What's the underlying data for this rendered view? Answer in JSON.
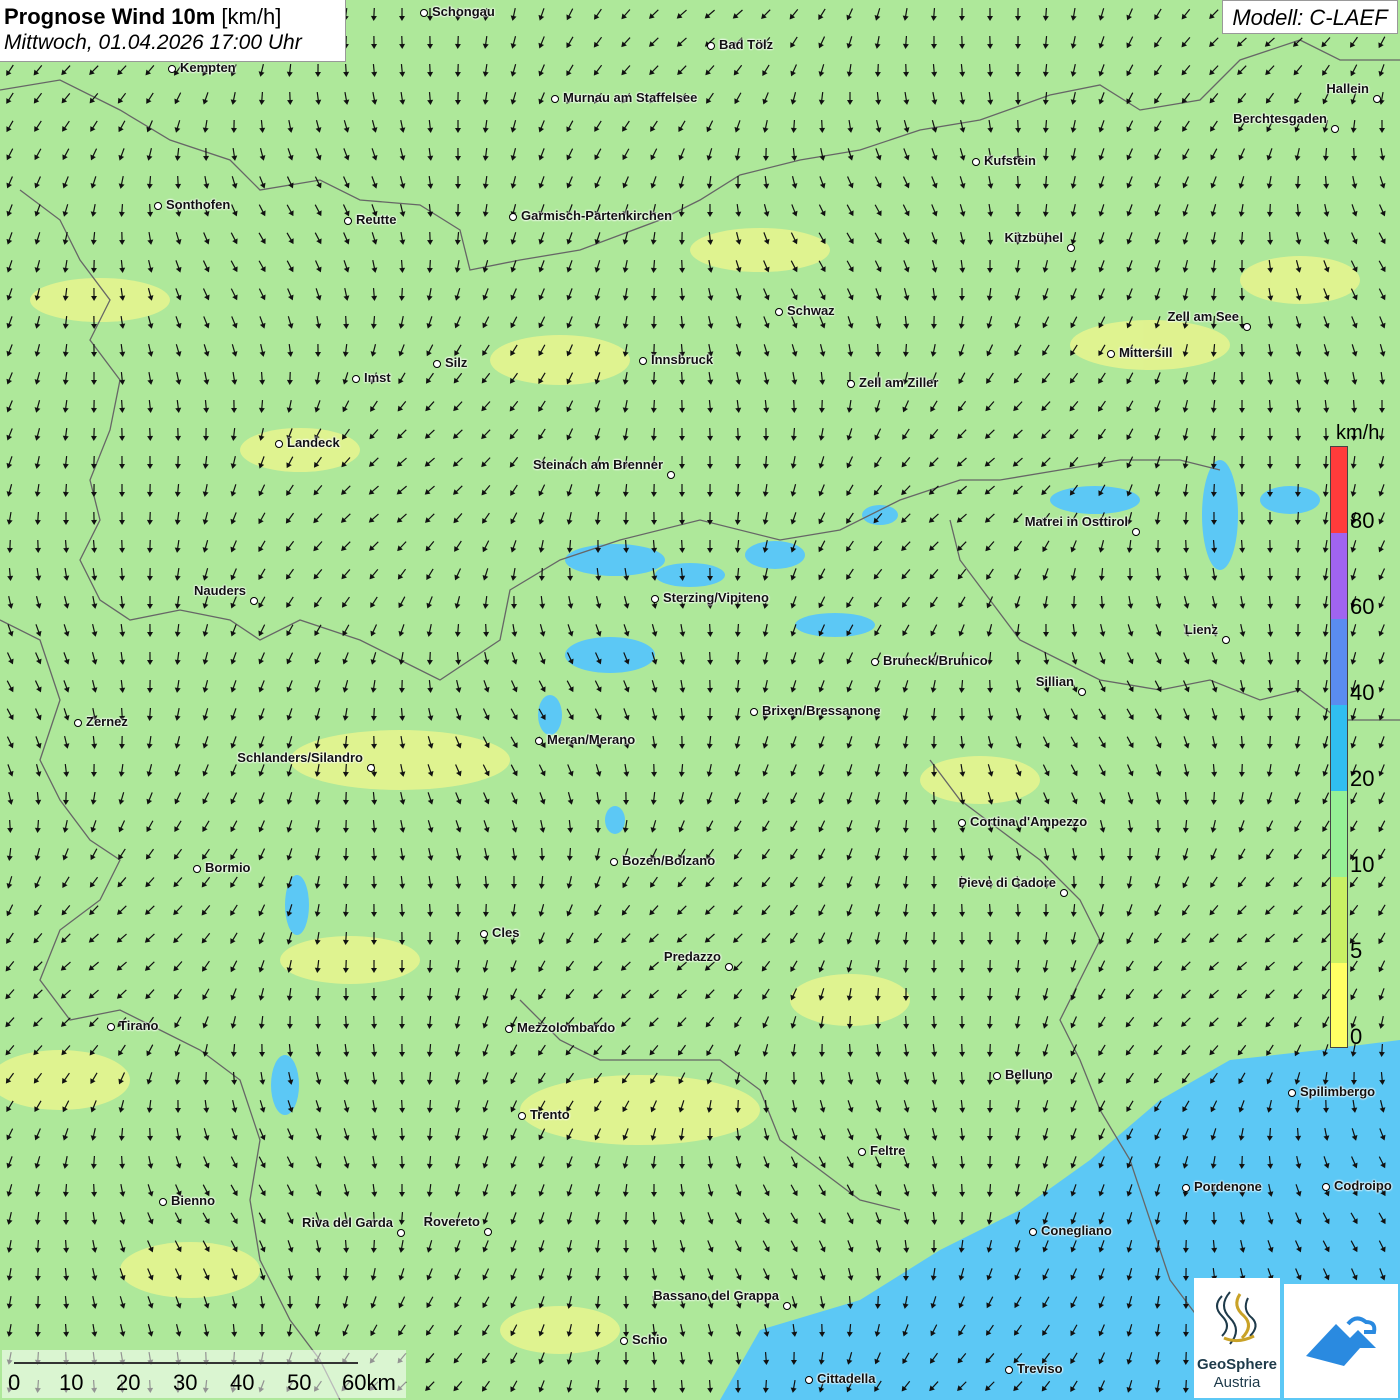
{
  "header": {
    "title_bold": "Prognose Wind 10m",
    "title_unit": "[km/h]",
    "datetime": "Mittwoch, 01.04.2026 17:00 Uhr",
    "model": "Modell: C-LAEF"
  },
  "legend": {
    "unit": "km/h",
    "ticks": [
      "80",
      "60",
      "40",
      "20",
      "10",
      "5",
      "0"
    ],
    "colors": [
      "#ff3b3b",
      "#a064f0",
      "#5a8cf0",
      "#30bef0",
      "#96f096",
      "#c8f064",
      "#ffff64"
    ]
  },
  "scale": {
    "labels": [
      "0",
      "10",
      "20",
      "30",
      "40",
      "50",
      "60km"
    ]
  },
  "logos": {
    "geosphere_line1": "GeoSphere",
    "geosphere_line2": "Austria"
  },
  "colors": {
    "land_green": "#aee89a",
    "land_yellow": "#ecf58c",
    "calm_blue": "#5cc8f5",
    "sea_blue": "#5cc8f5"
  },
  "places": [
    {
      "name": "Schongau"
    },
    {
      "name": "Bad Tölz"
    },
    {
      "name": "Kempten"
    },
    {
      "name": "Murnau am Staffelsee"
    },
    {
      "name": "Hallein"
    },
    {
      "name": "Berchtesgaden"
    },
    {
      "name": "Kufstein"
    },
    {
      "name": "Sonthofen"
    },
    {
      "name": "Reutte"
    },
    {
      "name": "Garmisch-Partenkirchen"
    },
    {
      "name": "Kitzbühel"
    },
    {
      "name": "Schwaz"
    },
    {
      "name": "Zell am See"
    },
    {
      "name": "Mittersill"
    },
    {
      "name": "Innsbruck"
    },
    {
      "name": "Silz"
    },
    {
      "name": "Imst"
    },
    {
      "name": "Zell am Ziller"
    },
    {
      "name": "Landeck"
    },
    {
      "name": "Steinach am Brenner"
    },
    {
      "name": "Matrei in Osttirol"
    },
    {
      "name": "Nauders"
    },
    {
      "name": "Sterzing/Vipiteno"
    },
    {
      "name": "Lienz"
    },
    {
      "name": "Bruneck/Brunico"
    },
    {
      "name": "Sillian"
    },
    {
      "name": "Brixen/Bressanone"
    },
    {
      "name": "Zernez"
    },
    {
      "name": "Meran/Merano"
    },
    {
      "name": "Schlanders/Silandro"
    },
    {
      "name": "Cortina d'Ampezzo"
    },
    {
      "name": "Bozen/Bolzano"
    },
    {
      "name": "Bormio"
    },
    {
      "name": "Pieve di Cadore"
    },
    {
      "name": "Cles"
    },
    {
      "name": "Predazzo"
    },
    {
      "name": "Tirano"
    },
    {
      "name": "Mezzolombardo"
    },
    {
      "name": "Belluno"
    },
    {
      "name": "Spilimbergo"
    },
    {
      "name": "Trento"
    },
    {
      "name": "Feltre"
    },
    {
      "name": "Pordenone"
    },
    {
      "name": "Codroipo"
    },
    {
      "name": "Bienno"
    },
    {
      "name": "Riva del Garda"
    },
    {
      "name": "Rovereto"
    },
    {
      "name": "Conegliano"
    },
    {
      "name": "Bassano del Grappa"
    },
    {
      "name": "Schio"
    },
    {
      "name": "Treviso"
    },
    {
      "name": "Cittadella"
    }
  ]
}
